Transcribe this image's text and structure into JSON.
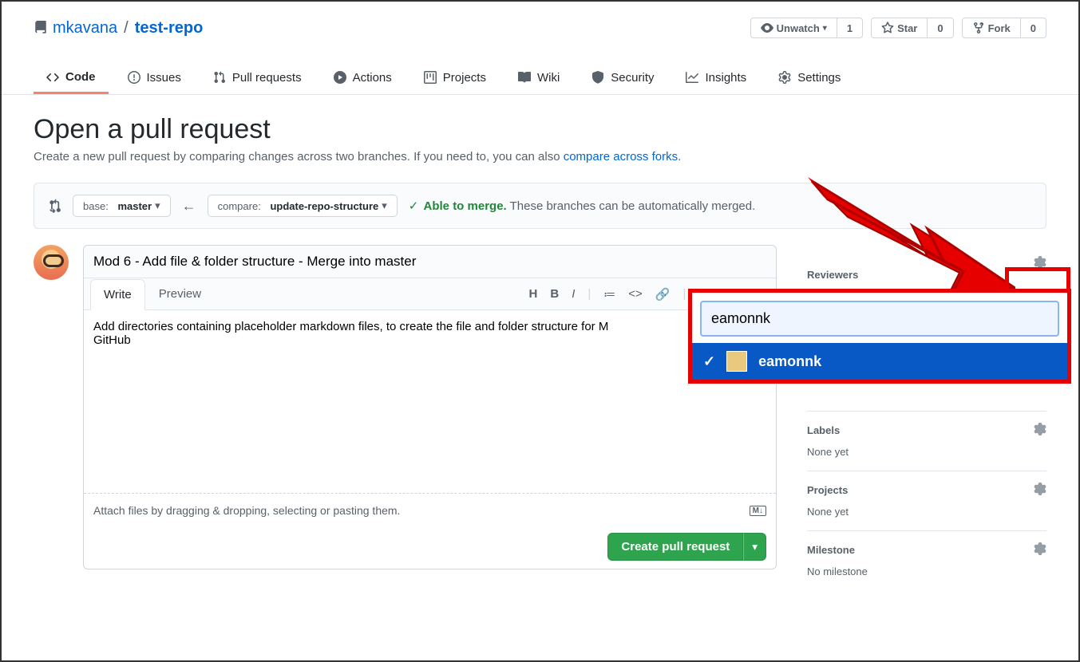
{
  "repo": {
    "owner": "mkavana",
    "name": "test-repo"
  },
  "header_buttons": {
    "unwatch": {
      "label": "Unwatch",
      "count": "1"
    },
    "star": {
      "label": "Star",
      "count": "0"
    },
    "fork": {
      "label": "Fork",
      "count": "0"
    }
  },
  "nav": {
    "code": "Code",
    "issues": "Issues",
    "pull_requests": "Pull requests",
    "actions": "Actions",
    "projects": "Projects",
    "wiki": "Wiki",
    "security": "Security",
    "insights": "Insights",
    "settings": "Settings"
  },
  "page": {
    "title": "Open a pull request",
    "subhead_pre": "Create a new pull request by comparing changes across two branches. If you need to, you can also ",
    "subhead_link": "compare across forks",
    "subhead_post": "."
  },
  "branches": {
    "base_prefix": "base:",
    "base_value": "master",
    "compare_prefix": "compare:",
    "compare_value": "update-repo-structure",
    "merge_ok": "Able to merge.",
    "merge_detail": "These branches can be automatically merged."
  },
  "pr_form": {
    "title_value": "Mod 6 - Add file & folder structure - Merge into master",
    "tab_write": "Write",
    "tab_preview": "Preview",
    "description_value": "Add directories containing placeholder markdown files, to create the file and folder structure for M\nGitHub",
    "attach_hint": "Attach files by dragging & dropping, selecting or pasting them.",
    "md_badge": "M↓",
    "submit_label": "Create pull request"
  },
  "sidebar": {
    "reviewers": {
      "label": "Reviewers"
    },
    "labels": {
      "label": "Labels",
      "none": "None yet"
    },
    "projects": {
      "label": "Projects",
      "none": "None yet"
    },
    "milestone": {
      "label": "Milestone",
      "none": "No milestone"
    }
  },
  "reviewer_popup": {
    "search_value": "eamonnk",
    "result_name": "eamonnk"
  }
}
